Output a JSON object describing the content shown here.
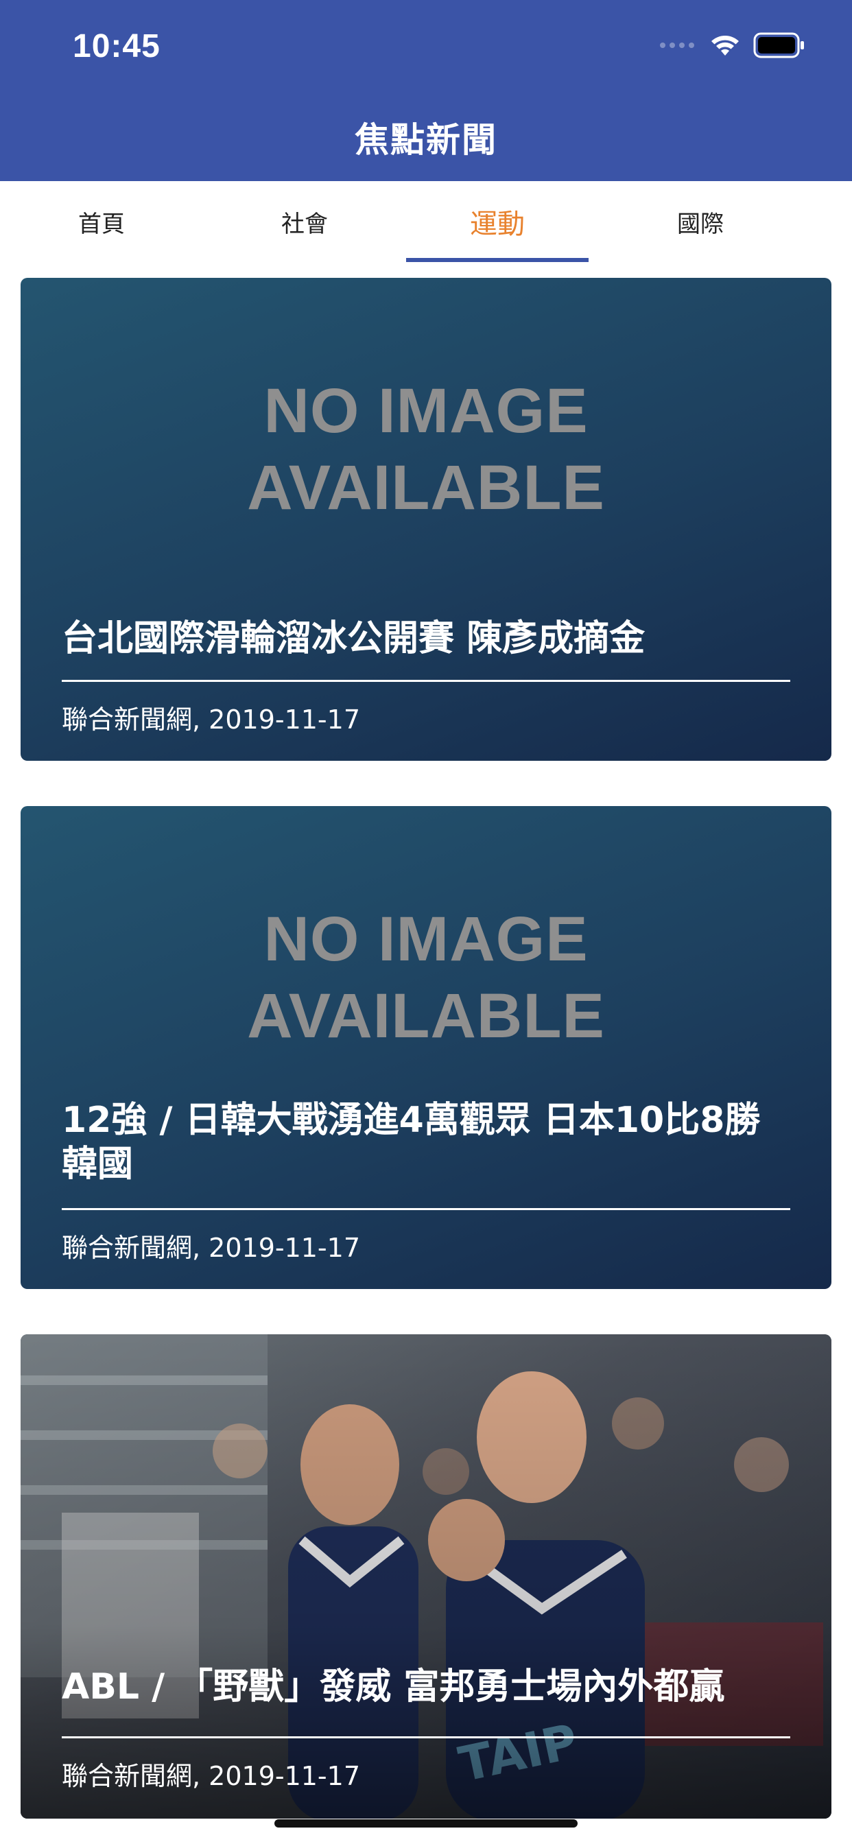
{
  "status_bar": {
    "time": "10:45"
  },
  "navbar": {
    "title": "焦點新聞"
  },
  "tabs": [
    {
      "label": "首頁",
      "active": false
    },
    {
      "label": "社會",
      "active": false
    },
    {
      "label": "運動",
      "active": true
    },
    {
      "label": "國際",
      "active": false
    }
  ],
  "articles": [
    {
      "placeholder_line1": "NO IMAGE",
      "placeholder_line2": "AVAILABLE",
      "title": "台北國際滑輪溜冰公開賽 陳彥成摘金",
      "meta": "聯合新聞網, 2019-11-17"
    },
    {
      "placeholder_line1": "NO IMAGE",
      "placeholder_line2": "AVAILABLE",
      "title": "12強 / 日韓大戰湧進4萬觀眾 日本10比8勝韓國",
      "meta": "聯合新聞網, 2019-11-17"
    },
    {
      "has_photo": true,
      "title": "ABL / 「野獸」發威 富邦勇士場內外都贏",
      "meta": "聯合新聞網, 2019-11-17"
    }
  ],
  "colors": {
    "navbar": "#3B54A7",
    "active_tab": "#E8822E",
    "indicator": "#3B54A7"
  }
}
